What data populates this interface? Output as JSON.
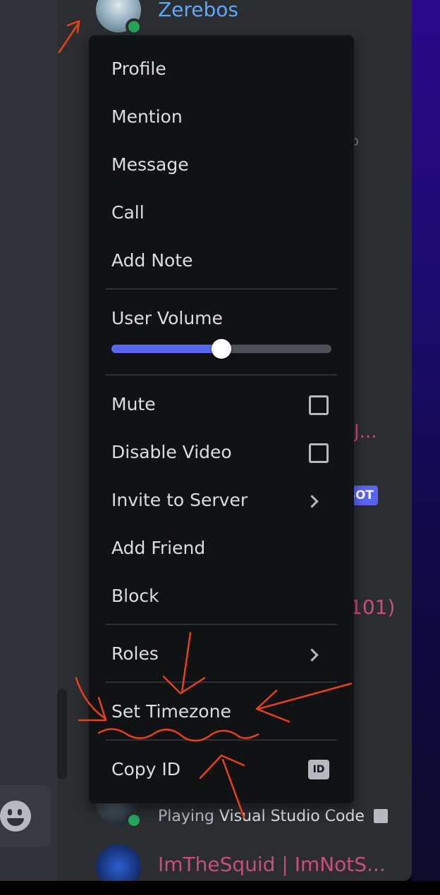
{
  "top_member": {
    "name": "Zerebos",
    "name_color": "#5ea7ff"
  },
  "partial_members": [
    {
      "text": "J...",
      "color": "#c94f78"
    },
    {
      "text": "101)",
      "color": "#c94f78"
    }
  ],
  "bot_badge": "BOT",
  "bottom_members": [
    {
      "activity_prefix": "Playing",
      "activity_name": "Visual Studio Code",
      "activity_icon": "document-icon"
    },
    {
      "name": "ImTheSquid | ImNotS...",
      "name_color": "#c94f78"
    }
  ],
  "context_menu": {
    "items": {
      "profile": "Profile",
      "mention": "Mention",
      "message": "Message",
      "call": "Call",
      "add_note": "Add Note",
      "user_volume": "User Volume",
      "mute": "Mute",
      "disable_video": "Disable Video",
      "invite_to_server": "Invite to Server",
      "add_friend": "Add Friend",
      "block": "Block",
      "roles": "Roles",
      "set_timezone": "Set Timezone",
      "copy_id": "Copy ID"
    },
    "user_volume_level": 0.5,
    "mute_checked": false,
    "disable_video_checked": false,
    "copy_id_badge": "ID"
  },
  "colors": {
    "accent": "#5865f2",
    "online": "#23a55a",
    "annotation": "#e8401c"
  }
}
